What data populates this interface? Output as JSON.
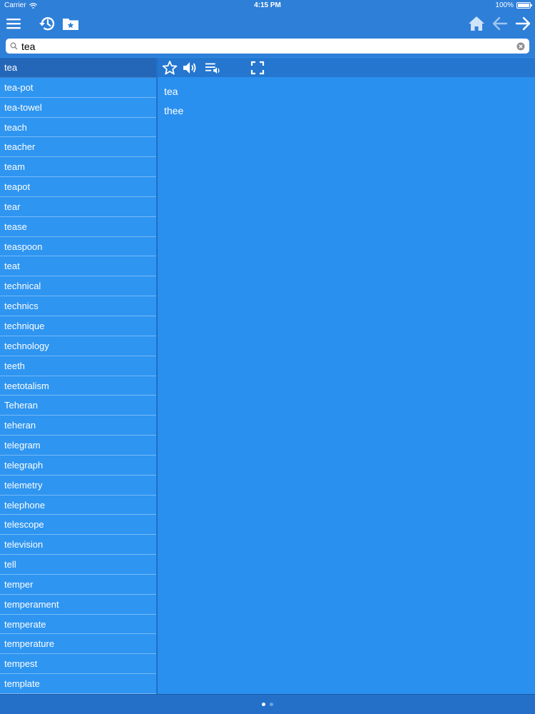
{
  "status_bar": {
    "carrier": "Carrier",
    "time": "4:15 PM",
    "battery": "100%"
  },
  "toolbar": {
    "menu_icon": "hamburger-menu-icon",
    "history_icon": "history-icon",
    "favorites_icon": "favorites-folder-icon",
    "home_icon": "home-icon",
    "back_icon": "arrow-left-icon",
    "forward_icon": "arrow-right-icon"
  },
  "search": {
    "value": "tea",
    "placeholder": ""
  },
  "word_list": [
    "tea",
    "tea-pot",
    "tea-towel",
    "teach",
    "teacher",
    "team",
    "teapot",
    "tear",
    "tease",
    "teaspoon",
    "teat",
    "technical",
    "technics",
    "technique",
    "technology",
    "teeth",
    "teetotalism",
    "Teheran",
    "teheran",
    "telegram",
    "telegraph",
    "telemetry",
    "telephone",
    "telescope",
    "television",
    "tell",
    "temper",
    "temperament",
    "temperate",
    "temperature",
    "tempest",
    "template"
  ],
  "selected_index": 0,
  "detail_toolbar": {
    "favorite_icon": "star-icon",
    "speak_icon": "speaker-icon",
    "playlist_icon": "playlist-audio-icon",
    "fullscreen_icon": "fullscreen-icon"
  },
  "detail": {
    "headword": "tea",
    "translation": "thee"
  },
  "pager": {
    "pages": 2,
    "current": 1
  },
  "colors": {
    "top_bar": "#2e7fd8",
    "list_bg": "#2e95f1",
    "selected_row": "#2467b8",
    "detail_bg": "#2a90ef"
  }
}
